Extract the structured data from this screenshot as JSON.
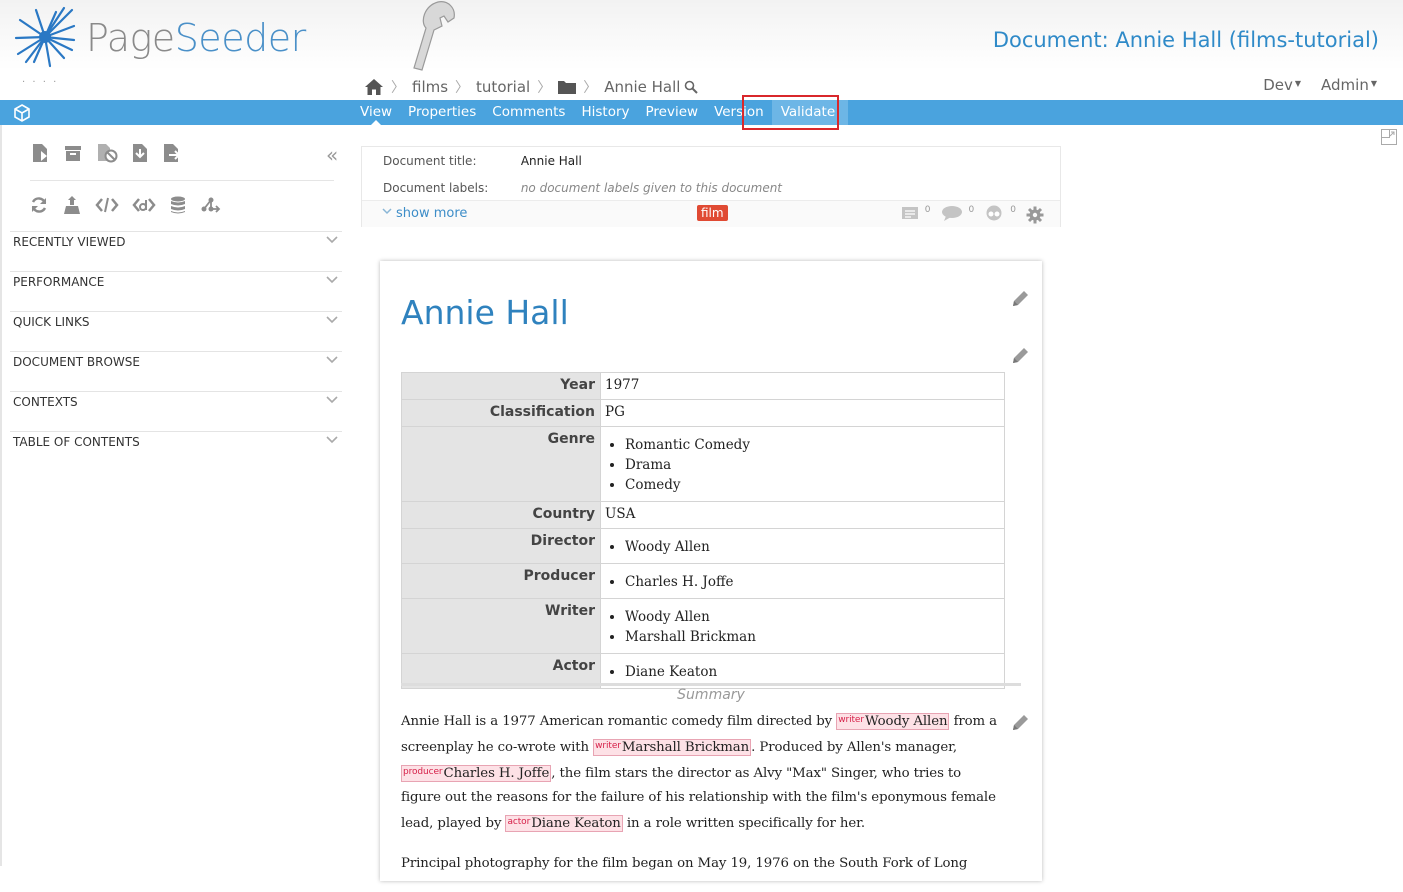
{
  "header": {
    "logo_text_a": "Page",
    "logo_text_b": "Seeder",
    "document_heading": "Document: Annie Hall (films-tutorial)",
    "user_menu": "· · · ·",
    "breadcrumb": [
      "films",
      "tutorial",
      "Annie Hall"
    ],
    "menus": [
      {
        "label": "Dev"
      },
      {
        "label": "Admin"
      }
    ]
  },
  "tabs": [
    "View",
    "Properties",
    "Comments",
    "History",
    "Preview",
    "Version",
    "Validate"
  ],
  "sidebar": {
    "collapse": "«",
    "sections": [
      "RECENTLY VIEWED",
      "PERFORMANCE",
      "QUICK LINKS",
      "DOCUMENT BROWSE",
      "CONTEXTS",
      "TABLE OF CONTENTS"
    ]
  },
  "meta": {
    "title_label": "Document title:",
    "title_value": "Annie Hall",
    "labels_label": "Document labels:",
    "labels_value": "no document labels given to this document",
    "show_more": "show more",
    "label_tag": "film",
    "counts": [
      "0",
      "0",
      "0"
    ]
  },
  "document": {
    "title": "Annie Hall",
    "properties": [
      {
        "key": "Year",
        "value": "1977"
      },
      {
        "key": "Classification",
        "value": "PG"
      },
      {
        "key": "Genre",
        "items": [
          "Romantic Comedy",
          "Drama",
          "Comedy"
        ]
      },
      {
        "key": "Country",
        "value": "USA"
      },
      {
        "key": "Director",
        "items": [
          "Woody Allen"
        ]
      },
      {
        "key": "Producer",
        "items": [
          "Charles H. Joffe"
        ]
      },
      {
        "key": "Writer",
        "items": [
          "Woody Allen",
          "Marshall Brickman"
        ]
      },
      {
        "key": "Actor",
        "items": [
          "Diane Keaton"
        ]
      }
    ],
    "summary_heading": "Summary",
    "summary_p1": [
      {
        "t": "Annie Hall is a 1977 American romantic comedy film directed by "
      },
      {
        "role": "writer",
        "t": "Woody Allen"
      },
      {
        "t": " from a screenplay he co-wrote with "
      },
      {
        "role": "writer",
        "t": "Marshall Brickman"
      },
      {
        "t": ". Produced by Allen's manager, "
      },
      {
        "role": "producer",
        "t": "Charles H. Joffe"
      },
      {
        "t": ", the film stars the director as Alvy \"Max\" Singer, who tries to figure out the reasons for the failure of his relationship with the film's eponymous female lead, played by "
      },
      {
        "role": "actor",
        "t": "Diane Keaton"
      },
      {
        "t": " in a role written specifically for her."
      }
    ],
    "summary_p2": "Principal photography for the film began on May 19, 1976 on the South Fork of Long"
  },
  "colors": {
    "navbar": "#4aa3de",
    "accent": "#2f8ac8",
    "label_tag": "#e04a33",
    "highlight_box": "#d9272b"
  }
}
